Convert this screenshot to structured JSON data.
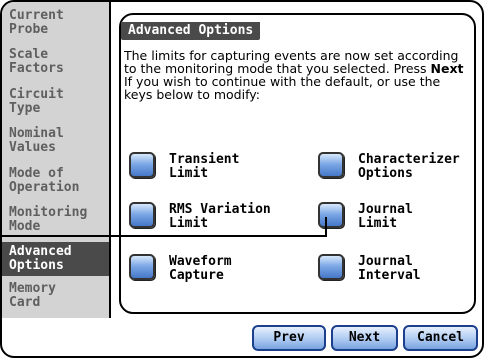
{
  "sidebar": {
    "items": [
      {
        "label": "Current\nProbe",
        "active": false
      },
      {
        "label": "Scale\nFactors",
        "active": false
      },
      {
        "label": "Circuit\nType",
        "active": false
      },
      {
        "label": "Nominal\nValues",
        "active": false
      },
      {
        "label": "Mode of\nOperation",
        "active": false
      },
      {
        "label": "Monitoring\nMode",
        "active": false
      },
      {
        "label": "Advanced\nOptions",
        "active": true
      },
      {
        "label": "Memory\nCard",
        "active": false
      }
    ]
  },
  "panel": {
    "title": "Advanced Options",
    "desc_pre": "The limits for capturing events are now set according to the monitoring mode that you selected. Press ",
    "desc_bold": "Next",
    "desc_post": " If you wish to continue with the default, or use the keys below to modify:"
  },
  "options": [
    {
      "label": "Transient\nLimit"
    },
    {
      "label": "Characterizer\nOptions"
    },
    {
      "label": "RMS Variation\nLimit"
    },
    {
      "label": "Journal\nLimit"
    },
    {
      "label": "Waveform\nCapture"
    },
    {
      "label": "Journal\nInterval"
    }
  ],
  "footer": {
    "prev_label": "Prev",
    "next_label": "Next",
    "cancel_label": "Cancel"
  },
  "colors": {
    "button_blue": "#7ea9e6",
    "sidebar_bg": "#d3d3d3",
    "active_bg": "#4a4a4a"
  }
}
